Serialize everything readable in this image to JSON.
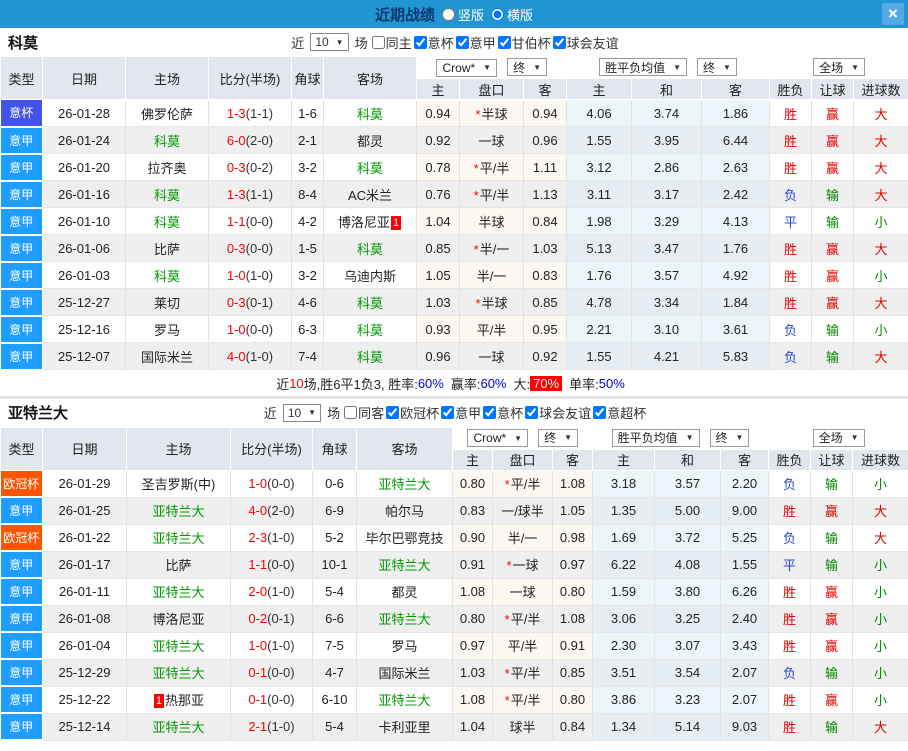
{
  "titlebar": {
    "title": "近期战绩",
    "vertical_label": "竖版",
    "horizontal_label": "横版",
    "horizontal_checked": "checked",
    "close_glyph": "×"
  },
  "icons": {
    "caret": "▼",
    "star": "*",
    "check": "✓"
  },
  "colors": {
    "topbar": "#2095d3",
    "serie_a": "#1e9fff",
    "coppa_italia": "#4153ea",
    "champions": "#ff5400",
    "team_green": "#009900",
    "score_red": "#ff0000",
    "hot_bg": "#ff0000",
    "link_blue": "#0000dd"
  },
  "sections": [
    {
      "team": "科莫",
      "filters": {
        "near": "近",
        "count": "10",
        "unit": "场",
        "same": "同主",
        "leagues": [
          "意杯",
          "意甲",
          "甘伯杯",
          "球会友谊"
        ]
      },
      "selects": {
        "source": "Crow*",
        "final": "终",
        "avg": "胜平负均值",
        "final2": "终",
        "scope": "全场"
      },
      "columns": [
        "类型",
        "日期",
        "主场",
        "比分(半场)",
        "角球",
        "客场",
        "主",
        "盘口",
        "客",
        "主",
        "和",
        "客",
        "胜负",
        "让球",
        "进球数"
      ],
      "rows": [
        {
          "t": "意杯",
          "tc": "#4153ea",
          "d": "26-01-28",
          "h": "佛罗伦萨",
          "hteam": false,
          "hb": "",
          "s": "1-3",
          "sh": "(1-1)",
          "cn": "1-6",
          "a": "科莫",
          "ateam": true,
          "ab": "",
          "oh": "0.94",
          "star": true,
          "line": "半球",
          "oa": "0.94",
          "m1": "4.06",
          "m2": "3.74",
          "m3": "1.86",
          "res": [
            "胜",
            "red"
          ],
          "han": [
            "赢",
            "red"
          ],
          "gl": [
            "大",
            "red"
          ]
        },
        {
          "t": "意甲",
          "tc": "#1e9fff",
          "d": "26-01-24",
          "h": "科莫",
          "hteam": true,
          "hb": "",
          "s": "6-0",
          "sh": "(2-0)",
          "cn": "2-1",
          "a": "都灵",
          "ateam": false,
          "ab": "",
          "oh": "0.92",
          "star": false,
          "line": "一球",
          "oa": "0.96",
          "m1": "1.55",
          "m2": "3.95",
          "m3": "6.44",
          "res": [
            "胜",
            "red"
          ],
          "han": [
            "赢",
            "red"
          ],
          "gl": [
            "大",
            "red"
          ]
        },
        {
          "t": "意甲",
          "tc": "#1e9fff",
          "d": "26-01-20",
          "h": "拉齐奥",
          "hteam": false,
          "hb": "",
          "s": "0-3",
          "sh": "(0-2)",
          "cn": "3-2",
          "a": "科莫",
          "ateam": true,
          "ab": "",
          "oh": "0.78",
          "star": true,
          "line": "平/半",
          "oa": "1.11",
          "m1": "3.12",
          "m2": "2.86",
          "m3": "2.63",
          "res": [
            "胜",
            "red"
          ],
          "han": [
            "赢",
            "red"
          ],
          "gl": [
            "大",
            "red"
          ]
        },
        {
          "t": "意甲",
          "tc": "#1e9fff",
          "d": "26-01-16",
          "h": "科莫",
          "hteam": true,
          "hb": "",
          "s": "1-3",
          "sh": "(1-1)",
          "cn": "8-4",
          "a": "AC米兰",
          "ateam": false,
          "ab": "",
          "oh": "0.76",
          "star": true,
          "line": "平/半",
          "oa": "1.13",
          "m1": "3.11",
          "m2": "3.17",
          "m3": "2.42",
          "res": [
            "负",
            "blue"
          ],
          "han": [
            "输",
            "green"
          ],
          "gl": [
            "大",
            "red"
          ]
        },
        {
          "t": "意甲",
          "tc": "#1e9fff",
          "d": "26-01-10",
          "h": "科莫",
          "hteam": true,
          "hb": "",
          "s": "1-1",
          "sh": "(0-0)",
          "cn": "4-2",
          "a": "博洛尼亚",
          "ateam": false,
          "ab": "1",
          "oh": "1.04",
          "star": false,
          "line": "半球",
          "oa": "0.84",
          "m1": "1.98",
          "m2": "3.29",
          "m3": "4.13",
          "res": [
            "平",
            "blue"
          ],
          "han": [
            "输",
            "green"
          ],
          "gl": [
            "小",
            "green"
          ]
        },
        {
          "t": "意甲",
          "tc": "#1e9fff",
          "d": "26-01-06",
          "h": "比萨",
          "hteam": false,
          "hb": "",
          "s": "0-3",
          "sh": "(0-0)",
          "cn": "1-5",
          "a": "科莫",
          "ateam": true,
          "ab": "",
          "oh": "0.85",
          "star": true,
          "line": "半/一",
          "oa": "1.03",
          "m1": "5.13",
          "m2": "3.47",
          "m3": "1.76",
          "res": [
            "胜",
            "red"
          ],
          "han": [
            "赢",
            "red"
          ],
          "gl": [
            "大",
            "red"
          ]
        },
        {
          "t": "意甲",
          "tc": "#1e9fff",
          "d": "26-01-03",
          "h": "科莫",
          "hteam": true,
          "hb": "",
          "s": "1-0",
          "sh": "(1-0)",
          "cn": "3-2",
          "a": "乌迪内斯",
          "ateam": false,
          "ab": "",
          "oh": "1.05",
          "star": false,
          "line": "半/一",
          "oa": "0.83",
          "m1": "1.76",
          "m2": "3.57",
          "m3": "4.92",
          "res": [
            "胜",
            "red"
          ],
          "han": [
            "赢",
            "red"
          ],
          "gl": [
            "小",
            "green"
          ]
        },
        {
          "t": "意甲",
          "tc": "#1e9fff",
          "d": "25-12-27",
          "h": "莱切",
          "hteam": false,
          "hb": "",
          "s": "0-3",
          "sh": "(0-1)",
          "cn": "4-6",
          "a": "科莫",
          "ateam": true,
          "ab": "",
          "oh": "1.03",
          "star": true,
          "line": "半球",
          "oa": "0.85",
          "m1": "4.78",
          "m2": "3.34",
          "m3": "1.84",
          "res": [
            "胜",
            "red"
          ],
          "han": [
            "赢",
            "red"
          ],
          "gl": [
            "大",
            "red"
          ]
        },
        {
          "t": "意甲",
          "tc": "#1e9fff",
          "d": "25-12-16",
          "h": "罗马",
          "hteam": false,
          "hb": "",
          "s": "1-0",
          "sh": "(0-0)",
          "cn": "6-3",
          "a": "科莫",
          "ateam": true,
          "ab": "",
          "oh": "0.93",
          "star": false,
          "line": "平/半",
          "oa": "0.95",
          "m1": "2.21",
          "m2": "3.10",
          "m3": "3.61",
          "res": [
            "负",
            "blue"
          ],
          "han": [
            "输",
            "green"
          ],
          "gl": [
            "小",
            "green"
          ]
        },
        {
          "t": "意甲",
          "tc": "#1e9fff",
          "d": "25-12-07",
          "h": "国际米兰",
          "hteam": false,
          "hb": "",
          "s": "4-0",
          "sh": "(1-0)",
          "cn": "7-4",
          "a": "科莫",
          "ateam": true,
          "ab": "",
          "oh": "0.96",
          "star": false,
          "line": "一球",
          "oa": "0.92",
          "m1": "1.55",
          "m2": "4.21",
          "m3": "5.83",
          "res": [
            "负",
            "blue"
          ],
          "han": [
            "输",
            "green"
          ],
          "gl": [
            "大",
            "red"
          ]
        }
      ],
      "summary": {
        "near": "近",
        "count": "10",
        "mid": "场,胜6平1负3, 胜率:",
        "win_rate": "60%",
        "label_win": "赢率:",
        "win_rate2": "60%",
        "label_big": "大:",
        "big_rate": "70%",
        "label_single": "单率:",
        "single_rate": "50%"
      }
    },
    {
      "team": "亚特兰大",
      "filters": {
        "near": "近",
        "count": "10",
        "unit": "场",
        "same": "同客",
        "leagues": [
          "欧冠杯",
          "意甲",
          "意杯",
          "球会友谊",
          "意超杯"
        ]
      },
      "selects": {
        "source": "Crow*",
        "final": "终",
        "avg": "胜平负均值",
        "final2": "终",
        "scope": "全场"
      },
      "columns": [
        "类型",
        "日期",
        "主场",
        "比分(半场)",
        "角球",
        "客场",
        "主",
        "盘口",
        "客",
        "主",
        "和",
        "客",
        "胜负",
        "让球",
        "进球数"
      ],
      "rows": [
        {
          "t": "欧冠杯",
          "tc": "#ff5400",
          "d": "26-01-29",
          "h": "圣吉罗斯(中)",
          "hteam": false,
          "hb": "",
          "s": "1-0",
          "sh": "(0-0)",
          "cn": "0-6",
          "a": "亚特兰大",
          "ateam": true,
          "ab": "",
          "oh": "0.80",
          "star": true,
          "line": "平/半",
          "oa": "1.08",
          "m1": "3.18",
          "m2": "3.57",
          "m3": "2.20",
          "res": [
            "负",
            "blue"
          ],
          "han": [
            "输",
            "green"
          ],
          "gl": [
            "小",
            "green"
          ]
        },
        {
          "t": "意甲",
          "tc": "#1e9fff",
          "d": "26-01-25",
          "h": "亚特兰大",
          "hteam": true,
          "hb": "",
          "s": "4-0",
          "sh": "(2-0)",
          "cn": "6-9",
          "a": "帕尔马",
          "ateam": false,
          "ab": "",
          "oh": "0.83",
          "star": false,
          "line": "一/球半",
          "oa": "1.05",
          "m1": "1.35",
          "m2": "5.00",
          "m3": "9.00",
          "res": [
            "胜",
            "red"
          ],
          "han": [
            "赢",
            "red"
          ],
          "gl": [
            "大",
            "red"
          ]
        },
        {
          "t": "欧冠杯",
          "tc": "#ff5400",
          "d": "26-01-22",
          "h": "亚特兰大",
          "hteam": true,
          "hb": "",
          "s": "2-3",
          "sh": "(1-0)",
          "cn": "5-2",
          "a": "毕尔巴鄂竞技",
          "ateam": false,
          "ab": "",
          "oh": "0.90",
          "star": false,
          "line": "半/一",
          "oa": "0.98",
          "m1": "1.69",
          "m2": "3.72",
          "m3": "5.25",
          "res": [
            "负",
            "blue"
          ],
          "han": [
            "输",
            "green"
          ],
          "gl": [
            "大",
            "red"
          ]
        },
        {
          "t": "意甲",
          "tc": "#1e9fff",
          "d": "26-01-17",
          "h": "比萨",
          "hteam": false,
          "hb": "",
          "s": "1-1",
          "sh": "(0-0)",
          "cn": "10-1",
          "a": "亚特兰大",
          "ateam": true,
          "ab": "",
          "oh": "0.91",
          "star": true,
          "line": "一球",
          "oa": "0.97",
          "m1": "6.22",
          "m2": "4.08",
          "m3": "1.55",
          "res": [
            "平",
            "blue"
          ],
          "han": [
            "输",
            "green"
          ],
          "gl": [
            "小",
            "green"
          ]
        },
        {
          "t": "意甲",
          "tc": "#1e9fff",
          "d": "26-01-11",
          "h": "亚特兰大",
          "hteam": true,
          "hb": "",
          "s": "2-0",
          "sh": "(1-0)",
          "cn": "5-4",
          "a": "都灵",
          "ateam": false,
          "ab": "",
          "oh": "1.08",
          "star": false,
          "line": "一球",
          "oa": "0.80",
          "m1": "1.59",
          "m2": "3.80",
          "m3": "6.26",
          "res": [
            "胜",
            "red"
          ],
          "han": [
            "赢",
            "red"
          ],
          "gl": [
            "小",
            "green"
          ]
        },
        {
          "t": "意甲",
          "tc": "#1e9fff",
          "d": "26-01-08",
          "h": "博洛尼亚",
          "hteam": false,
          "hb": "",
          "s": "0-2",
          "sh": "(0-1)",
          "cn": "6-6",
          "a": "亚特兰大",
          "ateam": true,
          "ab": "",
          "oh": "0.80",
          "star": true,
          "line": "平/半",
          "oa": "1.08",
          "m1": "3.06",
          "m2": "3.25",
          "m3": "2.40",
          "res": [
            "胜",
            "red"
          ],
          "han": [
            "赢",
            "red"
          ],
          "gl": [
            "小",
            "green"
          ]
        },
        {
          "t": "意甲",
          "tc": "#1e9fff",
          "d": "26-01-04",
          "h": "亚特兰大",
          "hteam": true,
          "hb": "",
          "s": "1-0",
          "sh": "(1-0)",
          "cn": "7-5",
          "a": "罗马",
          "ateam": false,
          "ab": "",
          "oh": "0.97",
          "star": false,
          "line": "平/半",
          "oa": "0.91",
          "m1": "2.30",
          "m2": "3.07",
          "m3": "3.43",
          "res": [
            "胜",
            "red"
          ],
          "han": [
            "赢",
            "red"
          ],
          "gl": [
            "小",
            "green"
          ]
        },
        {
          "t": "意甲",
          "tc": "#1e9fff",
          "d": "25-12-29",
          "h": "亚特兰大",
          "hteam": true,
          "hb": "",
          "s": "0-1",
          "sh": "(0-0)",
          "cn": "4-7",
          "a": "国际米兰",
          "ateam": false,
          "ab": "",
          "oh": "1.03",
          "star": true,
          "line": "平/半",
          "oa": "0.85",
          "m1": "3.51",
          "m2": "3.54",
          "m3": "2.07",
          "res": [
            "负",
            "blue"
          ],
          "han": [
            "输",
            "green"
          ],
          "gl": [
            "小",
            "green"
          ]
        },
        {
          "t": "意甲",
          "tc": "#1e9fff",
          "d": "25-12-22",
          "h": "热那亚",
          "hteam": false,
          "hb": "1",
          "s": "0-1",
          "sh": "(0-0)",
          "cn": "6-10",
          "a": "亚特兰大",
          "ateam": true,
          "ab": "",
          "oh": "1.08",
          "star": true,
          "line": "平/半",
          "oa": "0.80",
          "m1": "3.86",
          "m2": "3.23",
          "m3": "2.07",
          "res": [
            "胜",
            "red"
          ],
          "han": [
            "赢",
            "red"
          ],
          "gl": [
            "小",
            "green"
          ]
        },
        {
          "t": "意甲",
          "tc": "#1e9fff",
          "d": "25-12-14",
          "h": "亚特兰大",
          "hteam": true,
          "hb": "",
          "s": "2-1",
          "sh": "(1-0)",
          "cn": "5-4",
          "a": "卡利亚里",
          "ateam": false,
          "ab": "",
          "oh": "1.04",
          "star": false,
          "line": "球半",
          "oa": "0.84",
          "m1": "1.34",
          "m2": "5.14",
          "m3": "9.03",
          "res": [
            "胜",
            "red"
          ],
          "han": [
            "输",
            "green"
          ],
          "gl": [
            "大",
            "red"
          ]
        }
      ]
    }
  ]
}
